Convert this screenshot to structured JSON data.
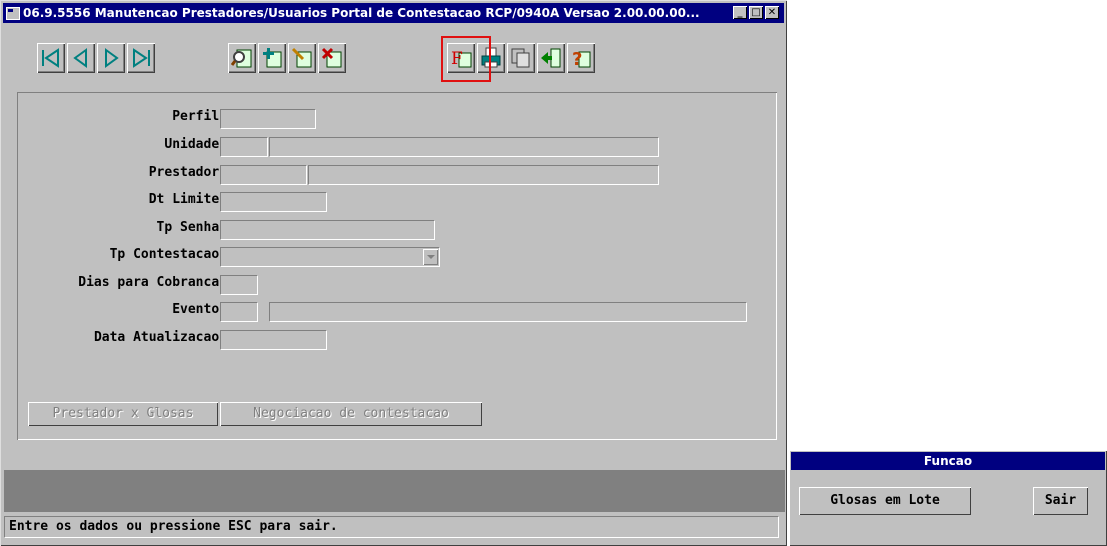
{
  "window": {
    "title": "06.9.5556 Manutencao Prestadores/Usuarios Portal de Contestacao RCP/0940A Versao 2.00.00.00...",
    "controls": [
      "minimize",
      "maximize",
      "close"
    ]
  },
  "toolbar": {
    "groups": [
      [
        "first-record",
        "previous-record",
        "next-record",
        "last-record"
      ],
      [
        "search-record",
        "add-record",
        "edit-record",
        "delete-record"
      ],
      [
        "function-key",
        "print",
        "copy",
        "exit",
        "help"
      ]
    ],
    "highlighted": "function-key",
    "highlight_color": "#e01010"
  },
  "form": {
    "perfil": {
      "label": "Perfil:",
      "value": ""
    },
    "unidade": {
      "label": "Unidade:",
      "code": "",
      "name": ""
    },
    "prestador": {
      "label": "Prestador:",
      "code": "",
      "name": ""
    },
    "dt_limite": {
      "label": "Dt Limite:",
      "value": ""
    },
    "tp_senha": {
      "label": "Tp Senha:",
      "value": ""
    },
    "tp_contestacao": {
      "label": "Tp Contestacao:",
      "value": ""
    },
    "dias_cobranca": {
      "label": "Dias para Cobranca:",
      "value": ""
    },
    "evento": {
      "label": "Evento:",
      "code": "",
      "name": ""
    },
    "data_atualizacao": {
      "label": "Data Atualizacao:",
      "value": ""
    }
  },
  "buttons": {
    "prestador_glosas": "Prestador x Glosas",
    "negociacao": "Negociacao de contestacao"
  },
  "status": "Entre os dados ou pressione ESC para sair.",
  "funcao": {
    "title": "Funcao",
    "glosas_lote": "Glosas em Lote",
    "sair": "Sair"
  },
  "colors": {
    "titlebar": "#000080",
    "window": "#c0c0c0",
    "icon_accent": "#008080"
  }
}
